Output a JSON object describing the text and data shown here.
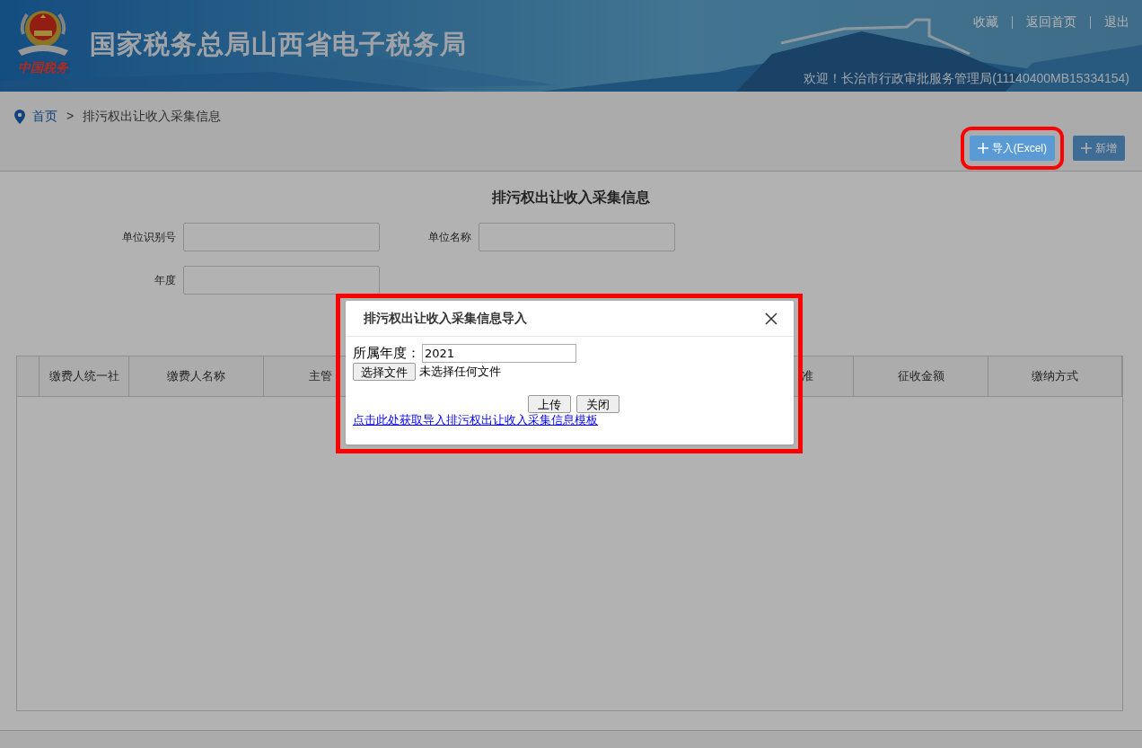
{
  "header": {
    "title": "国家税务总局山西省电子税务局",
    "emblem_caption": "中国税务",
    "links": [
      "收藏",
      "返回首页",
      "退出"
    ],
    "welcome": "欢迎！长治市行政审批服务管理局(11140400MB15334154)"
  },
  "breadcrumb": {
    "items": [
      "首页",
      "排污权出让收入采集信息"
    ],
    "separator": ">"
  },
  "toolbar": {
    "buttons": [
      {
        "label": "导入(Excel)",
        "highlighted": true
      },
      {
        "label": "新增",
        "highlighted": false
      }
    ]
  },
  "panel": {
    "title": "排污权出让收入采集信息",
    "filters": [
      {
        "label": "单位识别号"
      },
      {
        "label": "单位名称"
      },
      {
        "label": "年度"
      }
    ]
  },
  "table": {
    "columns": [
      "缴费人统一社",
      "缴费人名称",
      "主管",
      "准",
      "征收金额",
      "缴纳方式"
    ]
  },
  "dialog": {
    "title": "排污权出让收入采集信息导入",
    "highlighted": true,
    "year_label": "所属年度：",
    "year_value": "2021",
    "file_button": "选择文件",
    "file_status": "未选择任何文件",
    "buttons": [
      "上传",
      "关闭"
    ],
    "template_link": "点击此处获取导入排污权出让收入采集信息模板"
  }
}
